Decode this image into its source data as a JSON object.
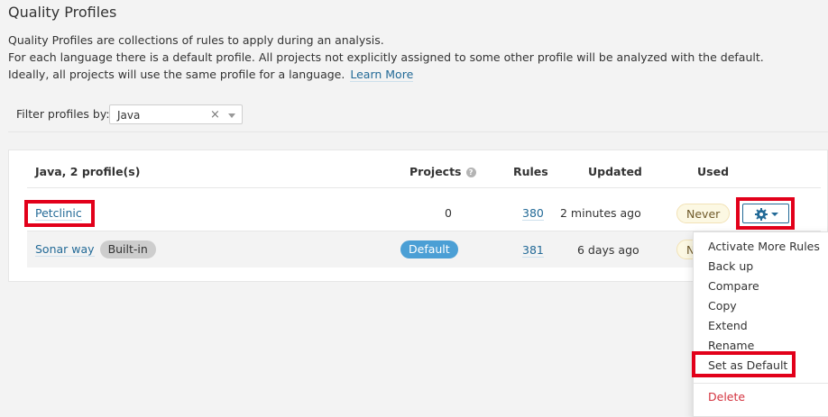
{
  "page": {
    "title": "Quality Profiles",
    "desc1": "Quality Profiles are collections of rules to apply during an analysis.",
    "desc2": "For each language there is a default profile. All projects not explicitly assigned to some other profile will be analyzed with the default.",
    "desc3": "Ideally, all projects will use the same profile for a language.",
    "learn_more": "Learn More"
  },
  "filter": {
    "label": "Filter profiles by:",
    "value": "Java",
    "clear_icon": "×"
  },
  "table": {
    "title": "Java, 2 profile(s)",
    "headers": {
      "projects": "Projects",
      "rules": "Rules",
      "updated": "Updated",
      "used": "Used"
    },
    "rows": [
      {
        "name": "Petclinic",
        "projects": "0",
        "rules": "380",
        "updated": "2 minutes ago",
        "used": "Never"
      },
      {
        "name": "Sonar way",
        "badge": "Built-in",
        "projects": "Default",
        "rules": "381",
        "updated": "6 days ago",
        "used": "Never"
      }
    ]
  },
  "menu": {
    "items": [
      "Activate More Rules",
      "Back up",
      "Compare",
      "Copy",
      "Extend",
      "Rename",
      "Set as Default"
    ],
    "delete": "Delete"
  },
  "colors": {
    "link": "#236a97",
    "highlight": "#e2001a",
    "default_badge": "#4b9fd5",
    "never_badge": "#fcf8e3"
  },
  "icons": {
    "projects_help": "question-circle-icon",
    "actions": "gear-icon",
    "caret": "caret-down-icon",
    "clear": "clear-icon"
  }
}
